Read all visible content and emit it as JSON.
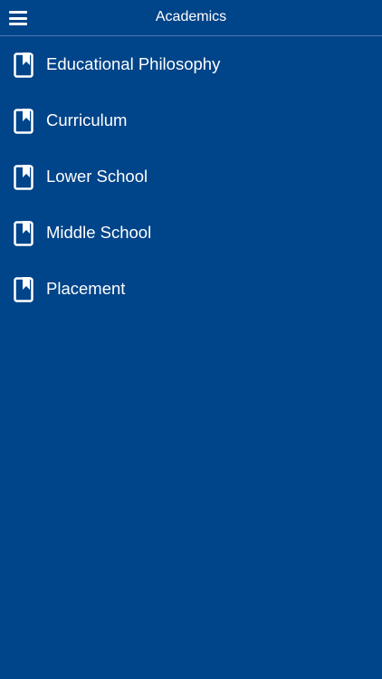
{
  "header": {
    "title": "Academics",
    "menu_icon": "hamburger-menu-icon"
  },
  "colors": {
    "background": "#004489",
    "text": "#ffffff",
    "divider": "#4d7bb3"
  },
  "list": {
    "item_icon": "book-icon",
    "items": [
      {
        "label": "Educational Philosophy"
      },
      {
        "label": "Curriculum"
      },
      {
        "label": "Lower School"
      },
      {
        "label": "Middle School"
      },
      {
        "label": "Placement"
      }
    ]
  }
}
